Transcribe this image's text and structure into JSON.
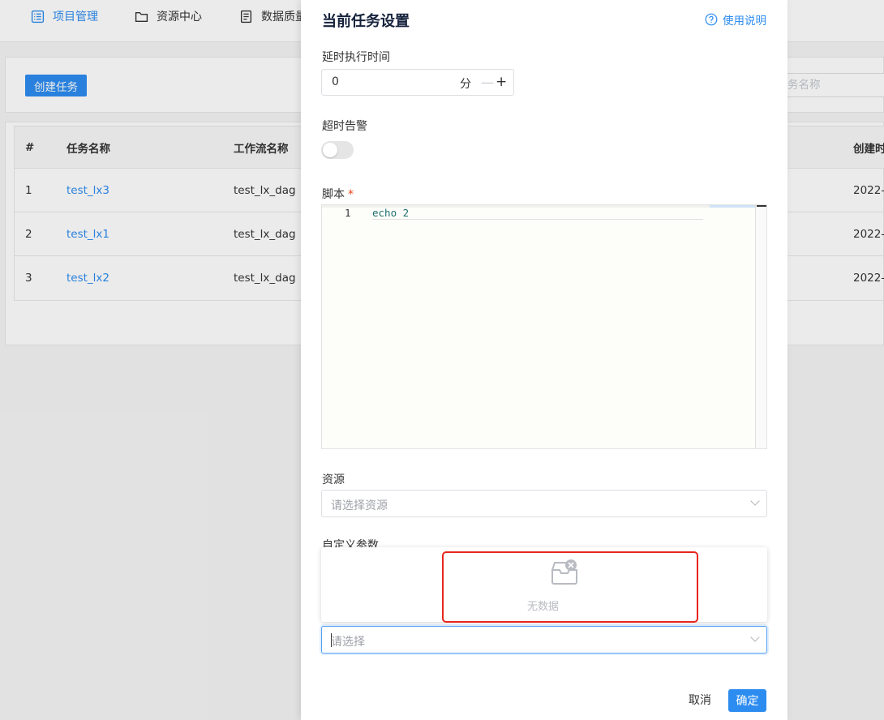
{
  "nav": {
    "items": [
      {
        "label": "项目管理",
        "icon": "list-icon",
        "active": true
      },
      {
        "label": "资源中心",
        "icon": "folder-icon",
        "active": false
      },
      {
        "label": "数据质量",
        "icon": "document-icon",
        "active": false
      }
    ]
  },
  "toolbar": {
    "create_label": "创建任务",
    "search_placeholder": "务名称"
  },
  "table": {
    "headers": [
      "#",
      "任务名称",
      "工作流名称",
      "创建时"
    ],
    "rows": [
      {
        "index": "1",
        "task": "test_lx3",
        "workflow": "test_lx_dag",
        "created": "2022-"
      },
      {
        "index": "2",
        "task": "test_lx1",
        "workflow": "test_lx_dag",
        "created": "2022-"
      },
      {
        "index": "3",
        "task": "test_lx2",
        "workflow": "test_lx_dag",
        "created": "2022-"
      }
    ]
  },
  "drawer": {
    "title": "当前任务设置",
    "help_label": "使用说明",
    "delay_label": "延时执行时间",
    "delay_value": "0",
    "delay_unit": "分",
    "timeout_label": "超时告警",
    "timeout_enabled": false,
    "script_label": "脚本",
    "script_required": "*",
    "script_line_number": "1",
    "script_code": "echo 2",
    "resource_label": "资源",
    "resource_placeholder": "请选择资源",
    "custom_param_label": "自定义参数",
    "empty_text": "无数据",
    "select_placeholder": "请选择",
    "cancel_label": "取消",
    "ok_label": "确定"
  },
  "colors": {
    "primary": "#2d8cf0",
    "highlight_border": "#e8261d",
    "required": "#ed4014"
  }
}
